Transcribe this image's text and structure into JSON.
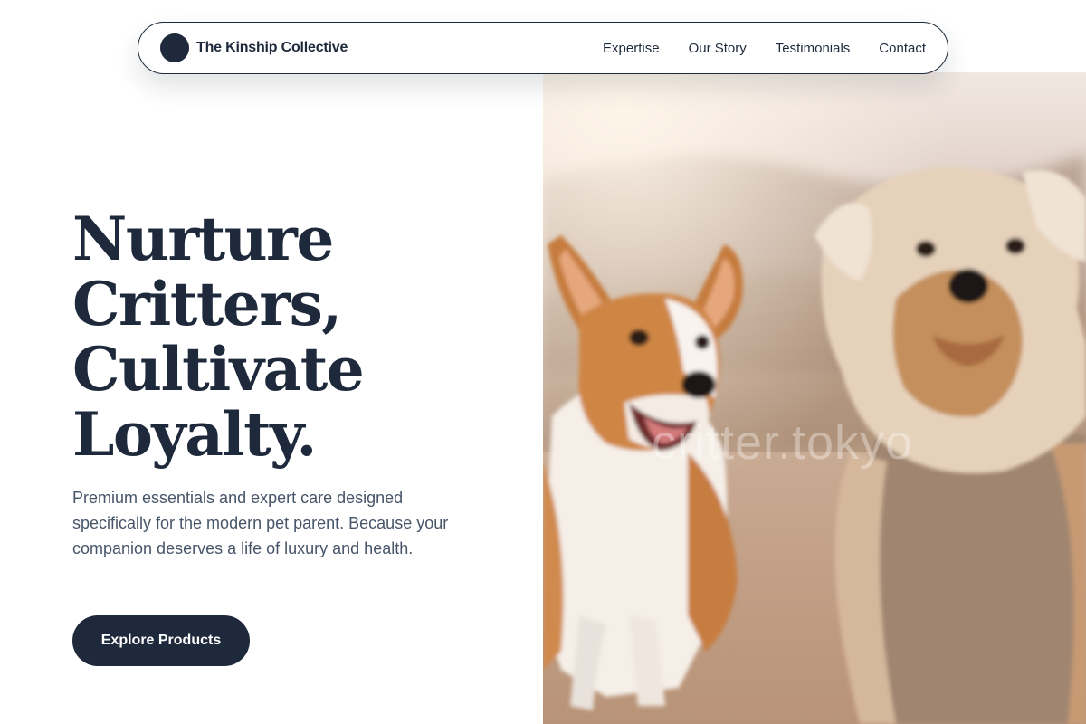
{
  "brand": {
    "name": "The Kinship Collective",
    "logo_icon": "circle-logo-icon"
  },
  "nav": {
    "links": [
      "Expertise",
      "Our Story",
      "Testimonials",
      "Contact"
    ]
  },
  "hero": {
    "title_lines": [
      "Nurture",
      "Critters,",
      "Cultivate",
      "Loyalty."
    ],
    "description": "Premium essentials and expert care designed specifically for the modern pet parent. Because your companion deserves a life of luxury and health.",
    "cta_label": "Explore Products",
    "image_watermark": "critter.tokyo"
  },
  "colors": {
    "primary": "#1e293b",
    "text_muted": "#475569",
    "background": "#ffffff"
  }
}
